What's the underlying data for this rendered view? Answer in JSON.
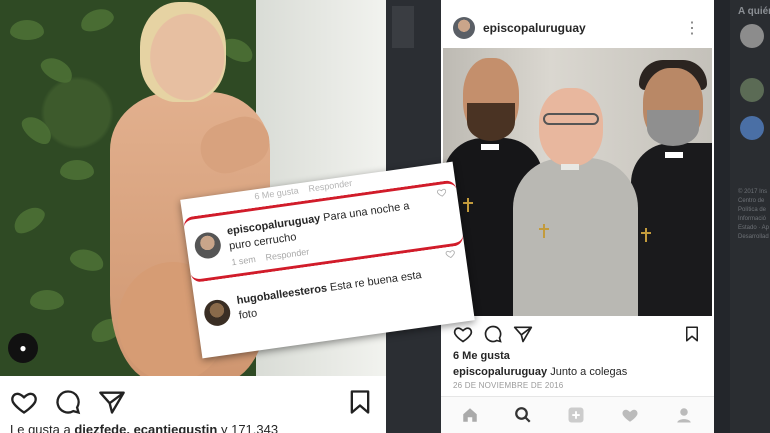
{
  "left_post": {
    "caption_text": "Le gusta a ",
    "caption_users": "diezfede, ecantiegustin",
    "caption_count": " y 171.343"
  },
  "card": {
    "top_likes": "6 Me gusta",
    "top_reply": "Responder",
    "comment1": {
      "user": "episcopaluruguay",
      "text": " Para una noche a puro cerrucho",
      "time": "1 sem",
      "reply": "Responder"
    },
    "comment2": {
      "user": "hugoballeesteros",
      "text": " Esta re buena esta foto"
    }
  },
  "right_post": {
    "username": "episcopaluruguay",
    "likes": "6 Me gusta",
    "caption_user": "episcopaluruguay",
    "caption_text": " Junto a colegas",
    "date": "26 DE NOVIEMBRE DE 2016"
  },
  "sidebar": {
    "title": "A quién",
    "footer": [
      "© 2017 Ins",
      "Centro de",
      "Política de",
      "Informació",
      "Estado · Ap",
      "Desarrollad"
    ]
  },
  "icons": {
    "heart": "heart-icon",
    "comment": "comment-icon",
    "share": "share-icon",
    "bookmark": "bookmark-icon",
    "more": "more-dots-icon",
    "home": "home-icon",
    "search": "search-icon",
    "add": "add-icon",
    "activity": "activity-heart-icon",
    "profile": "profile-icon"
  }
}
